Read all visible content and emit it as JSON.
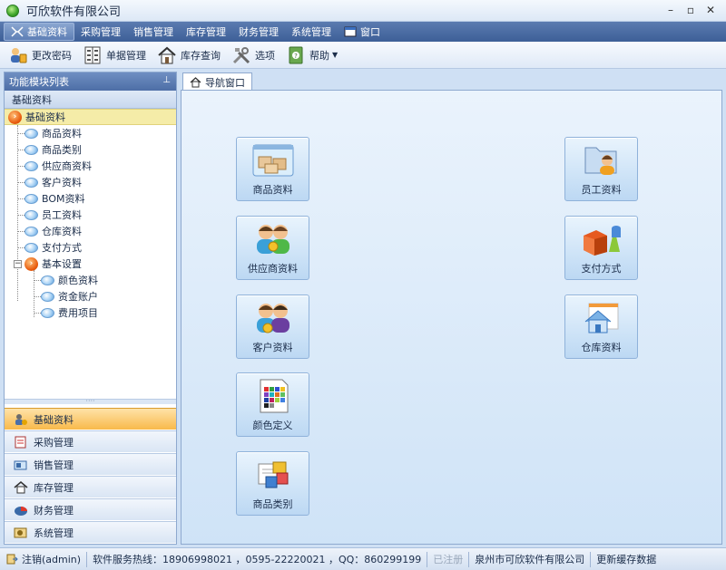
{
  "window": {
    "title": "可欣软件有限公司",
    "min": "–",
    "restore": "▫",
    "close": "✕"
  },
  "menu": [
    {
      "label": "基础资料",
      "active": true
    },
    {
      "label": "采购管理"
    },
    {
      "label": "销售管理"
    },
    {
      "label": "库存管理"
    },
    {
      "label": "财务管理"
    },
    {
      "label": "系统管理"
    },
    {
      "label": "窗口"
    }
  ],
  "toolbar": {
    "change_password": "更改密码",
    "document_mgmt": "单据管理",
    "stock_query": "库存查询",
    "options": "选项",
    "help": "帮助"
  },
  "left_panel": {
    "title": "功能模块列表",
    "group": "基础资料",
    "tree": {
      "root": "基础资料",
      "items": [
        "商品资料",
        "商品类别",
        "供应商资料",
        "客户资料",
        "BOM资料",
        "员工资料",
        "仓库资料",
        "支付方式"
      ],
      "subgroup": "基本设置",
      "sub_items": [
        "颜色资料",
        "资金账户",
        "费用项目"
      ]
    },
    "splitter": "····",
    "nav": [
      "基础资料",
      "采购管理",
      "销售管理",
      "库存管理",
      "财务管理",
      "系统管理"
    ]
  },
  "tab": {
    "label": "导航窗口"
  },
  "modules": {
    "product": "商品资料",
    "supplier": "供应商资料",
    "customer": "客户资料",
    "color": "颜色定义",
    "category": "商品类别",
    "employee": "员工资料",
    "payment": "支付方式",
    "warehouse": "仓库资料"
  },
  "status": {
    "logout": "注销(admin)",
    "hotline": "软件服务热线：18906998021 ，0595-22220021 ，QQ：860299199",
    "registered": "已注册",
    "company": "泉州市可欣软件有限公司",
    "refresh": "更新缓存数据"
  }
}
